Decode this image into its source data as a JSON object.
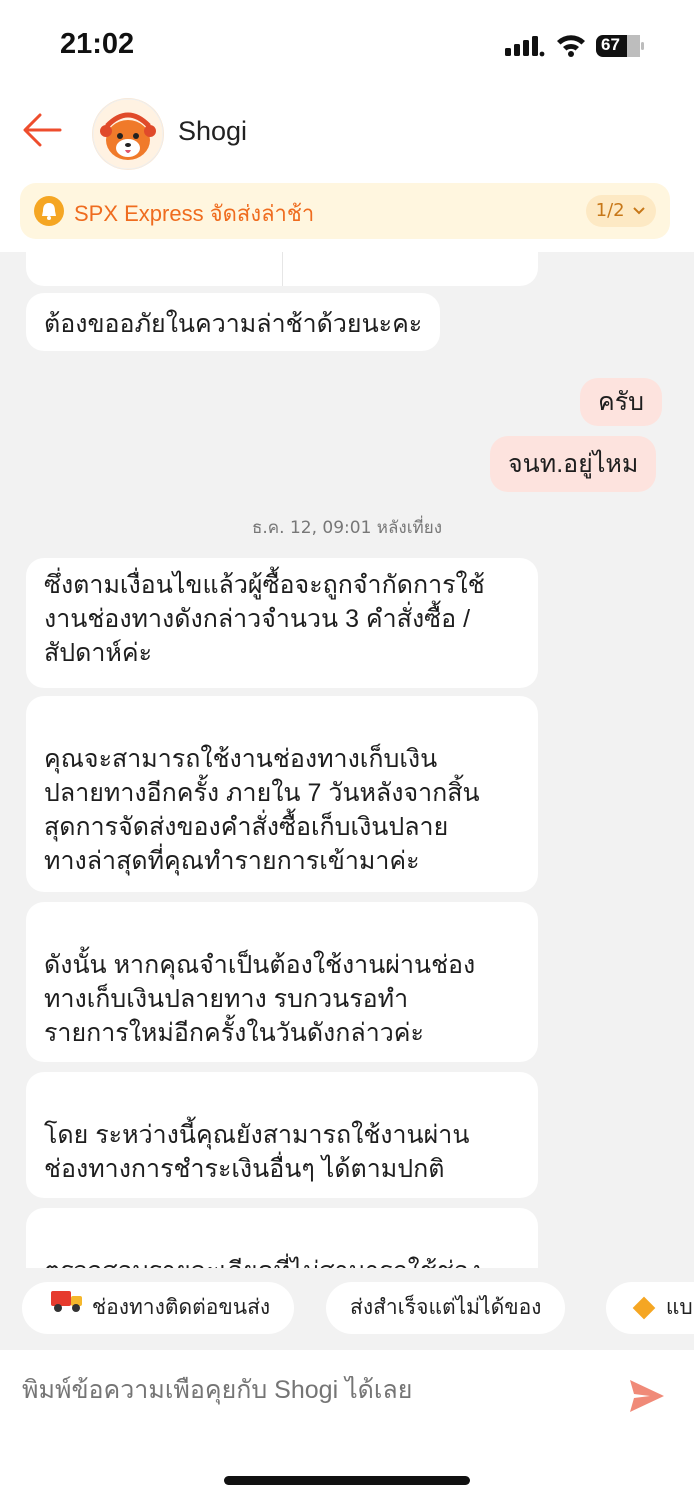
{
  "status_bar": {
    "time": "21:02",
    "battery": "67"
  },
  "header": {
    "shop_name": "Shogi"
  },
  "banner": {
    "text": "SPX Express จัดส่งล่าช้า",
    "count": "1/2"
  },
  "messages": [
    {
      "text": "ต้องขออภัยในความล่าช้าด้วยนะคะ"
    },
    {
      "text": "ครับ"
    },
    {
      "text": "จนท.อยู่ไหม"
    },
    {
      "text": "ซึ่งตามเงื่อนไขแล้วผู้ซื้อจะถูกจำกัดการใช้\nงานช่องทางดังกล่าวจำนวน 3 คำสั่งซื้อ /\nสัปดาห์ค่ะ"
    },
    {
      "text": "คุณจะสามารถใช้งานช่องทางเก็บเงิน\nปลายทางอีกครั้ง ภายใน 7 วันหลังจากสิ้น\nสุดการจัดส่งของคำสั่งซื้อเก็บเงินปลาย\nทางล่าสุดที่คุณทำรายการเข้ามาค่ะ"
    },
    {
      "text": "ดังนั้น หากคุณจำเป็นต้องใช้งานผ่านช่อง\nทางเก็บเงินปลายทาง รบกวนรอทำ\nรายการใหม่อีกครั้งในวันดังกล่าวค่ะ"
    },
    {
      "text": "โดย ระหว่างนี้คุณยังสามารถใช้งานผ่าน\nช่องทางการชำระเงินอื่นๆ ได้ตามปกติ"
    },
    {
      "text": "ตรวจสอบรายละเอียดที่ไม่สามารถใช้ช่อง"
    }
  ],
  "timestamp": "ธ.ค. 12, 09:01 หลังเที่ยง",
  "quick_replies": [
    {
      "label": "ช่องทางติดต่อขนส่ง",
      "icon": "truck-icon"
    },
    {
      "label": "ส่งสำเร็จแต่ไม่ได้ของ"
    },
    {
      "label": "แบ",
      "icon": "diamond-icon"
    }
  ],
  "input": {
    "placeholder": "พิมพ์ข้อความเพื่อคุยกับ Shogi ได้เลย"
  },
  "colors": {
    "accent": "#ee4d2d",
    "mine_bubble": "#fde3de",
    "banner_bg": "#fff6df",
    "banner_text": "#ef6c1f"
  }
}
